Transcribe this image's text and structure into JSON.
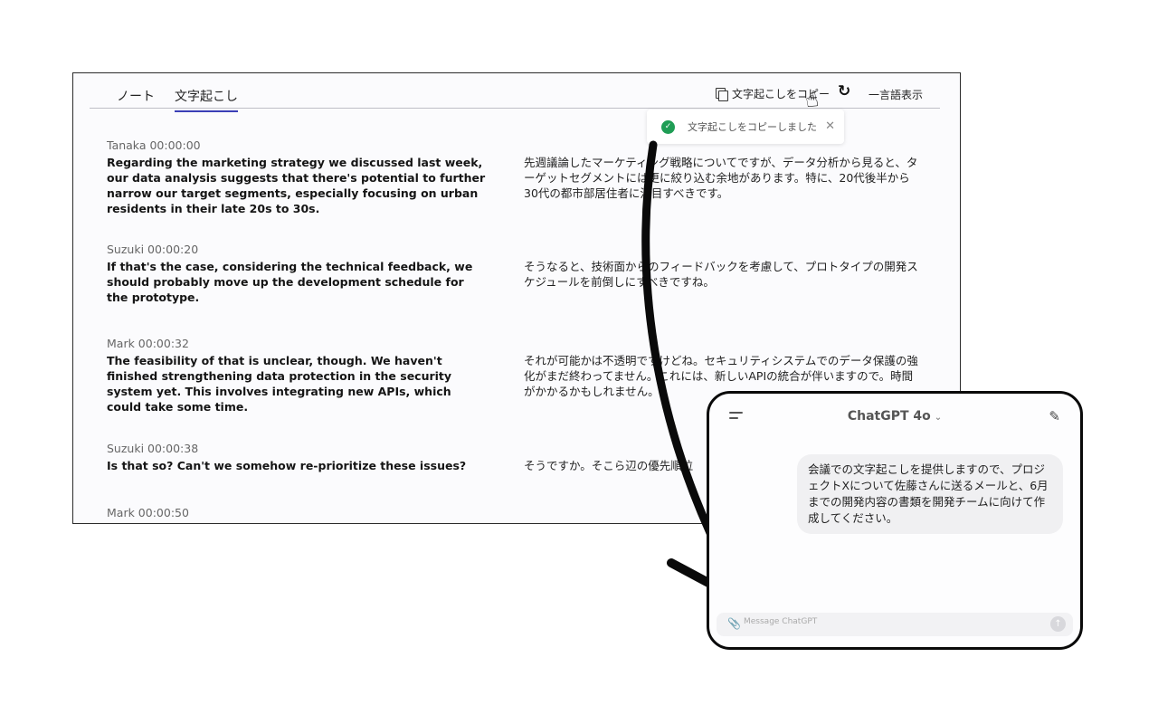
{
  "tabs": {
    "notes": "ノート",
    "transcript": "文字起こし"
  },
  "toolbar": {
    "copy_label": "文字起こしをコピー",
    "mono_label": "一言語表示",
    "refresh_icon": "refresh-icon"
  },
  "toast": {
    "message": "文字起こしをコピーしました",
    "close": "✕"
  },
  "entries": [
    {
      "speaker": "Tanaka 00:00:00",
      "en": "Regarding the marketing strategy we discussed last week, our data analysis suggests that there's potential to further narrow our target segments, especially focusing on urban residents in their late 20s to 30s.",
      "ja": "先週議論したマーケティング戦略についてですが、データ分析から見ると、ターゲットセグメントには更に絞り込む余地があります。特に、20代後半から30代の都市部居住者に注目すべきです。"
    },
    {
      "speaker": "Suzuki 00:00:20",
      "en": "If that's the case, considering the technical feedback, we should probably move up the development schedule for the prototype.",
      "ja": "そうなると、技術面からのフィードバックを考慮して、プロトタイプの開発スケジュールを前倒しにすべきですね。"
    },
    {
      "speaker": "Mark 00:00:32",
      "en": "The feasibility of that is unclear, though. We haven't finished strengthening data protection in the security system yet. This involves integrating new APIs, which could take some time.",
      "ja": "それが可能かは不透明ですけどね。セキュリティシステムでのデータ保護の強化がまだ終わってません。これには、新しいAPIの統合が伴いますので。時間がかかるかもしれません。"
    },
    {
      "speaker": "Suzuki 00:00:38",
      "en": "Is that so? Can't we somehow re-prioritize these issues?",
      "ja": "そうですか。そこら辺の優先順位"
    },
    {
      "speaker": "Mark 00:00:50",
      "en": "",
      "ja": ""
    }
  ],
  "chat": {
    "title": "ChatGPT 4o",
    "message": "会議での文字起こしを提供しますので、プロジェクトXについて佐藤さんに送るメールと、6月までの開発内容の書類を開発チームに向けて作成してください。",
    "placeholder": "Message ChatGPT"
  },
  "colors": {
    "tab_underline": "#3b3fb6",
    "toast_check": "#1f9d55",
    "panel_border": "#0a0a0a"
  }
}
